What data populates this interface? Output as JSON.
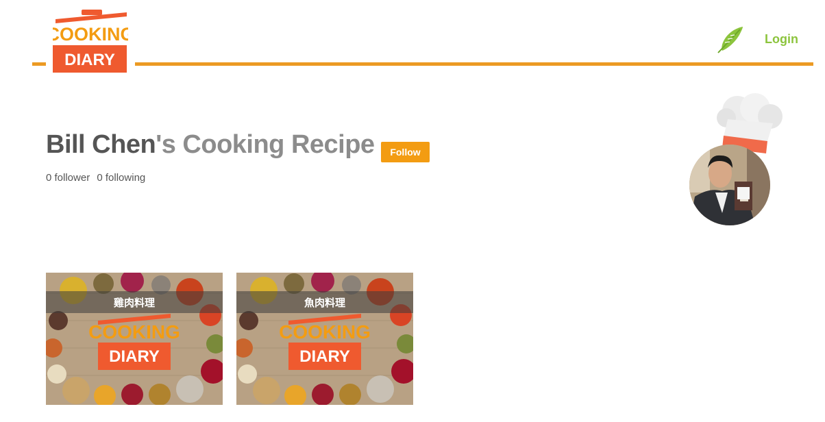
{
  "brand": {
    "logo_top": "COOKING",
    "logo_bottom": "DIARY",
    "color_primary": "#ec9a23",
    "color_logo_red": "#ef5a2f"
  },
  "nav": {
    "icon": "feather-icon",
    "login_label": "Login",
    "login_color": "#8cc43d"
  },
  "profile": {
    "name": "Bill Chen",
    "title_suffix": "'s Cooking Recipe",
    "follow_label": "Follow",
    "followers_text": "0 follower",
    "following_text": "0 following",
    "avatar_icon": "chef-hat-icon"
  },
  "recipes": [
    {
      "title": "雞肉料理",
      "cover_logo_top": "COOKING",
      "cover_logo_bottom": "DIARY"
    },
    {
      "title": "魚肉料理",
      "cover_logo_top": "COOKING",
      "cover_logo_bottom": "DIARY"
    }
  ]
}
